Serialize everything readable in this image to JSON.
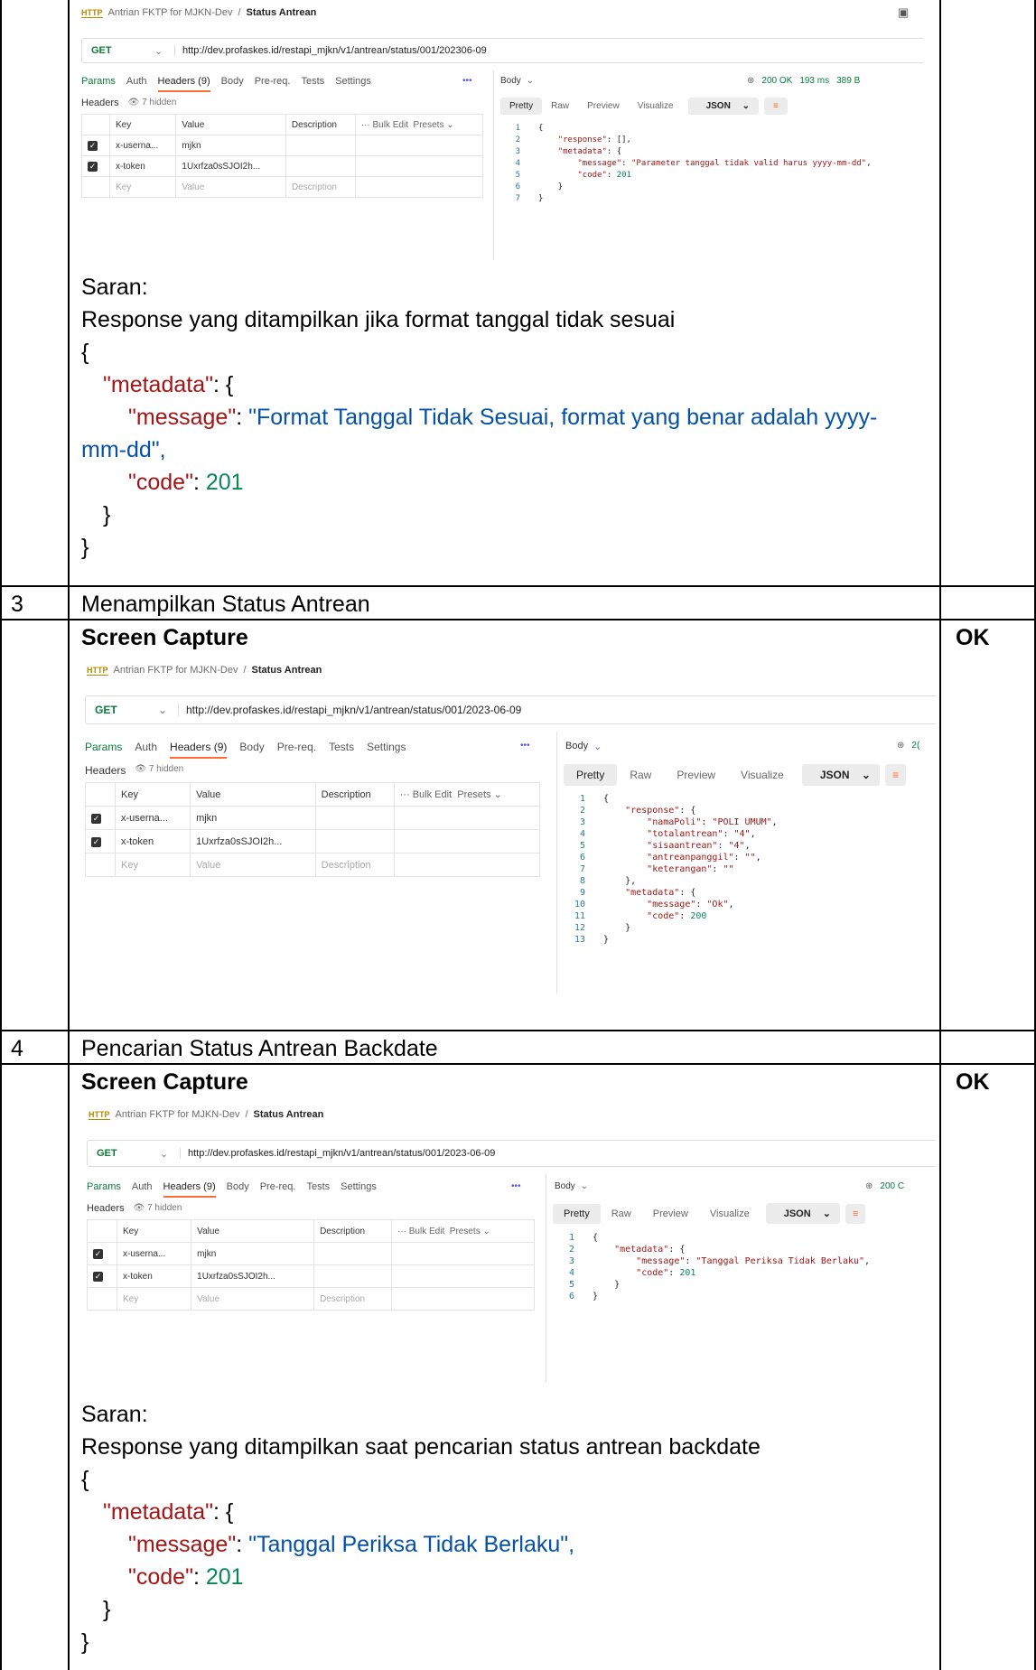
{
  "rows": [
    {
      "num": "3",
      "title": "Menampilkan Status Antrean",
      "status": "OK"
    },
    {
      "num": "4",
      "title": "Pencarian Status Antrean Backdate",
      "status": "OK"
    }
  ],
  "screen_capture_label": "Screen Capture",
  "postman": {
    "http_badge": "HTTP",
    "collection": "Antrian FKTP for MJKN-Dev",
    "separator": "/",
    "request_name": "Status Antrean",
    "method": "GET",
    "url_1": "http://dev.profaskes.id/restapi_mjkn/v1/antrean/status/001/202306-09",
    "url_2": "http://dev.profaskes.id/restapi_mjkn/v1/antrean/status/001/2023-06-09",
    "tabs": [
      "Params",
      "Auth",
      "Headers (9)",
      "Body",
      "Pre-req.",
      "Tests",
      "Settings"
    ],
    "more": "•••",
    "headers_label": "Headers",
    "hidden_label": "7 hidden",
    "col_key": "Key",
    "col_value": "Value",
    "col_desc": "Description",
    "bulk_edit": "Bulk Edit",
    "presets": "Presets",
    "row1_key": "x-userna...",
    "row1_val": "mjkn",
    "row2_key": "x-token",
    "row2_val": "1Uxrfza0sSJOI2h...",
    "body_label": "Body",
    "status_ok": "200 OK",
    "time": "193 ms",
    "size": "389 B",
    "resp_tabs": [
      "Pretty",
      "Raw",
      "Preview",
      "Visualize"
    ],
    "json_label": "JSON",
    "status_partial_2": "2(",
    "status_partial_3": "200 C"
  },
  "code1": [
    "{",
    "    \"response\": [],",
    "    \"metadata\": {",
    "        \"message\": \"Parameter tanggal tidak valid harus yyyy-mm-dd\",",
    "        \"code\": 201",
    "    }",
    "}"
  ],
  "code2": [
    "{",
    "    \"response\": {",
    "        \"namaPoli\": \"POLI UMUM\",",
    "        \"totalantrean\": \"4\",",
    "        \"sisaantrean\": \"4\",",
    "        \"antreanpanggil\": \"\",",
    "        \"keterangan\": \"\"",
    "    },",
    "    \"metadata\": {",
    "        \"message\": \"Ok\",",
    "        \"code\": 200",
    "    }",
    "}"
  ],
  "code3": [
    "{",
    "    \"metadata\": {",
    "        \"message\": \"Tanggal Periksa Tidak Berlaku\",",
    "        \"code\": 201",
    "    }",
    "}"
  ],
  "saran1": {
    "label": "Saran:",
    "desc": "Response yang ditampilkan jika format tanggal tidak sesuai",
    "open": "{",
    "metadata_key": "\"metadata\"",
    "colon_brace": ": {",
    "message_key": "\"message\"",
    "message_val": "\"Format Tanggal Tidak Sesuai, format yang benar adalah yyyy-mm-dd\",",
    "code_key": "\"code\"",
    "code_val": "201",
    "close_inner": "}",
    "close": "}"
  },
  "saran2": {
    "label": "Saran:",
    "desc": "Response yang ditampilkan saat pencarian status antrean backdate",
    "open": "{",
    "metadata_key": "\"metadata\"",
    "colon_brace": ": {",
    "message_key": "\"message\"",
    "message_val": "\"Tanggal Periksa Tidak Berlaku\",",
    "code_key": "\"code\"",
    "code_val": "201",
    "close_inner": "}",
    "close": "}"
  }
}
